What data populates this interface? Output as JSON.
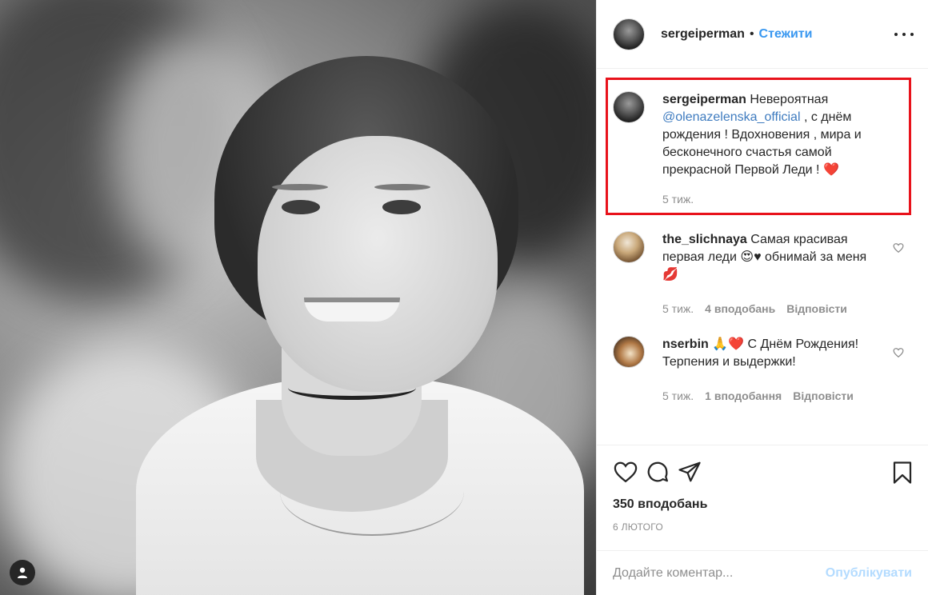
{
  "colors": {
    "accent": "#3897f0",
    "mention": "#3e7bbf",
    "highlight_box": "#e8121b",
    "muted": "#8e8e8e",
    "publish_disabled": "#b3dbff"
  },
  "header": {
    "username": "sergeiperman",
    "separator": "•",
    "follow_label": "Стежити"
  },
  "caption": {
    "username": "sergeiperman",
    "text_before": " Невероятная ",
    "mention": "@olenazelenska_official",
    "text_after": " , с днём рождения ! Вдохновения , мира и бесконечного счастья самой прекрасной Первой Леди ! ",
    "emoji": "❤️",
    "time": "5 тиж."
  },
  "comments": [
    {
      "username": "the_slichnaya",
      "text": " Самая красивая первая леди 😍♥ обнимай за меня 💋",
      "time": "5 тиж.",
      "likes": "4 вподобань",
      "reply": "Відповісти"
    },
    {
      "username": "nserbin",
      "text": " 🙏❤️ С Днём Рождения! Терпения и выдержки!",
      "time": "5 тиж.",
      "likes": "1 вподобання",
      "reply": "Відповісти"
    }
  ],
  "icons": [
    "heart-icon",
    "comment-icon",
    "share-icon",
    "bookmark-icon",
    "more-icon",
    "user-tag-icon"
  ],
  "likes_count": "350 вподобань",
  "date": "6 ЛЮТОГО",
  "add_comment": {
    "placeholder": "Додайте коментар...",
    "publish_label": "Опублікувати"
  }
}
